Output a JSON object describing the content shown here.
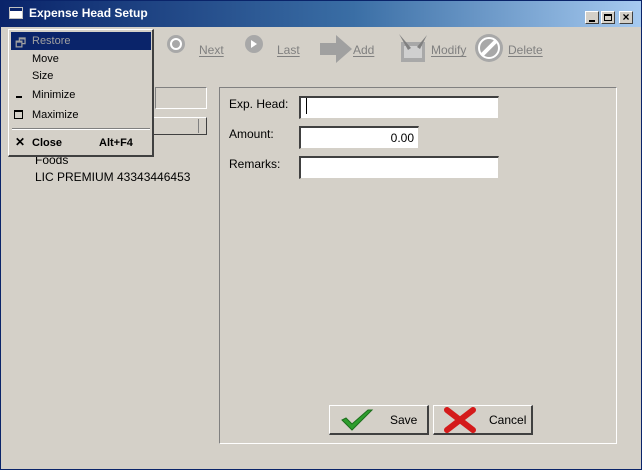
{
  "window": {
    "title": "Expense Head Setup"
  },
  "system_menu": {
    "items": [
      {
        "label": "Restore",
        "state": "highlighted-disabled",
        "icon": "restore-icon"
      },
      {
        "label": "Move"
      },
      {
        "label": "Size"
      },
      {
        "label": "Minimize",
        "icon": "minimize-icon"
      },
      {
        "label": "Maximize",
        "icon": "maximize-icon"
      },
      {
        "label": "Close",
        "shortcut": "Alt+F4",
        "icon": "close-x-icon"
      }
    ]
  },
  "toolbar": {
    "items": [
      {
        "label": "Next",
        "icon": "next-record-icon"
      },
      {
        "label": "Last",
        "icon": "last-record-icon"
      },
      {
        "label": "Add",
        "icon": "add-arrow-icon"
      },
      {
        "label": "Modify",
        "icon": "modify-icon"
      },
      {
        "label": "Delete",
        "icon": "delete-icon"
      }
    ]
  },
  "list": {
    "items": [
      "Foods",
      "LIC PREMIUM 43343446453"
    ]
  },
  "form": {
    "exp_head": {
      "label": "Exp. Head:",
      "value": ""
    },
    "amount": {
      "label": "Amount:",
      "value": "0.00"
    },
    "remarks": {
      "label": "Remarks:",
      "value": ""
    }
  },
  "buttons": {
    "save": {
      "label": "Save",
      "icon": "checkmark-icon"
    },
    "cancel": {
      "label": "Cancel",
      "icon": "red-x-icon"
    }
  },
  "colors": {
    "titlebar": "#0a246a",
    "face": "#d4d0c8",
    "menu_highlight": "#0a246a"
  }
}
